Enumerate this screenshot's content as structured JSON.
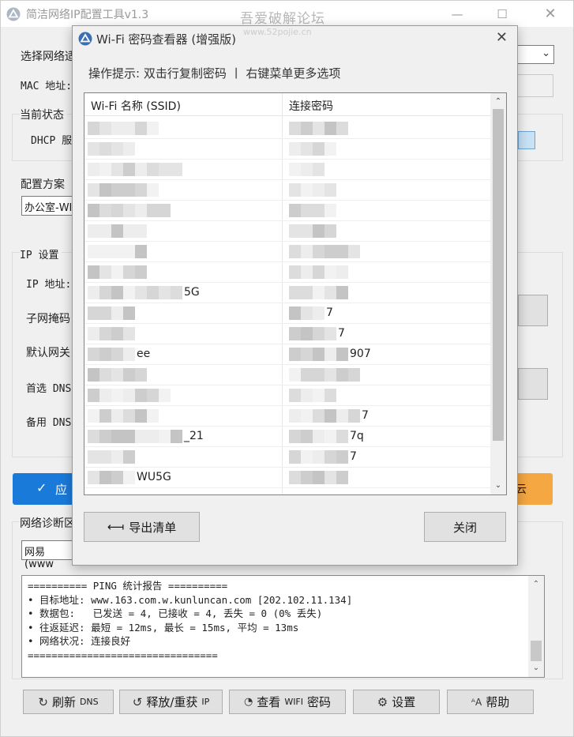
{
  "main": {
    "title": "简洁网络IP配置工具v1.3",
    "watermark": "吾爱破解论坛",
    "watermark_url": "www.52pojie.cn",
    "labels": {
      "select_adapter": "选择网络适",
      "mac": "MAC 地址:",
      "status": "当前状态",
      "dhcp": "DHCP 服",
      "scheme": "配置方案",
      "scheme_value": "办公室-WI",
      "ip_settings": "IP 设置",
      "ip_addr": "IP 地址:",
      "subnet": "子网掩码",
      "gateway": "默认网关",
      "dns1": "首选 DNS",
      "dns2": "备用 DNS",
      "diag": "网络诊断区",
      "diag_value": "网易 (www"
    },
    "apply_label": "应",
    "orange_label": "云",
    "console_text": "========== PING 统计报告 ==========\n• 目标地址: www.163.com.w.kunluncan.com [202.102.11.134]\n• 数据包:   已发送 = 4, 已接收 = 4, 丢失 = 0 (0% 丢失)\n• 往返延迟: 最短 = 12ms, 最长 = 15ms, 平均 = 13ms\n• 网络状况: 连接良好\n================================",
    "buttons": {
      "refresh_dns": "刷新",
      "refresh_dns_small": "DNS",
      "release_renew": "释放/重获",
      "release_renew_small": "IP",
      "view_wifi": "查看",
      "view_wifi_small": "WIFI",
      "view_wifi_tail": "密码",
      "settings": "设置",
      "help": "帮助"
    }
  },
  "dialog": {
    "title": "Wi-Fi 密码查看器 (增强版)",
    "hint": "操作提示: 双击行复制密码 丨 右键菜单更多选项",
    "columns": [
      "Wi-Fi 名称 (SSID)",
      "连接密码"
    ],
    "rows": [
      {
        "ssid_suffix": "",
        "pwd_suffix": ""
      },
      {
        "ssid_suffix": "",
        "pwd_suffix": ""
      },
      {
        "ssid_suffix": "",
        "pwd_suffix": ""
      },
      {
        "ssid_suffix": "",
        "pwd_suffix": ""
      },
      {
        "ssid_suffix": "",
        "pwd_suffix": ""
      },
      {
        "ssid_suffix": "",
        "pwd_suffix": ""
      },
      {
        "ssid_suffix": "",
        "pwd_suffix": ""
      },
      {
        "ssid_suffix": "",
        "pwd_suffix": ""
      },
      {
        "ssid_suffix": "5G",
        "pwd_suffix": ""
      },
      {
        "ssid_suffix": "",
        "pwd_suffix": "7"
      },
      {
        "ssid_suffix": "",
        "pwd_suffix": "7"
      },
      {
        "ssid_suffix": "ee",
        "pwd_suffix": "907"
      },
      {
        "ssid_suffix": "",
        "pwd_suffix": ""
      },
      {
        "ssid_suffix": "",
        "pwd_suffix": ""
      },
      {
        "ssid_suffix": "",
        "pwd_suffix": "7"
      },
      {
        "ssid_suffix": "_21",
        "pwd_suffix": "7q"
      },
      {
        "ssid_suffix": "",
        "pwd_suffix": "7"
      },
      {
        "ssid_suffix": "WU5G",
        "pwd_suffix": ""
      }
    ],
    "export_label": "导出清单",
    "close_label": "关闭"
  }
}
